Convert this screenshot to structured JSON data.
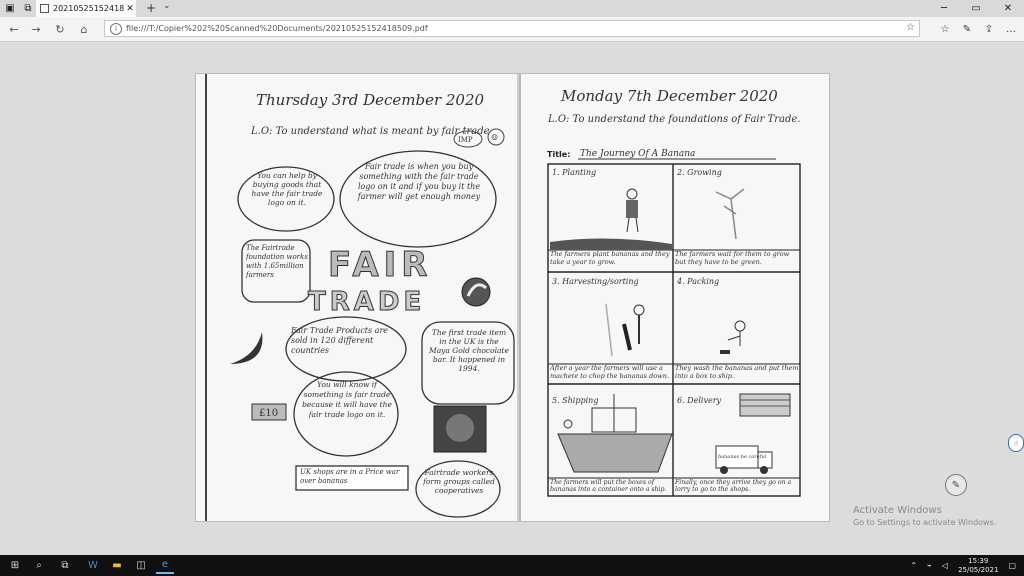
{
  "browser": {
    "tab_title": "20210525152418509.pc",
    "tab_close": "✕",
    "new_tab": "+",
    "address": "file:///T:/Copier%202%20Scanned%20Documents/20210525152418509.pdf",
    "window_controls": [
      "─",
      "▭",
      "✕"
    ]
  },
  "page_left": {
    "date": "Thursday 3rd December 2020",
    "lo": "L.O: To understand what is meant by fair trade",
    "imp": "IMP",
    "bubbles": [
      "You can help by buying goods that have the fair trade logo on it.",
      "Fair trade is when you buy something with the fair trade logo on it and if you buy it the farmer will get enough money",
      "The Fairtrade foundation works with 1.65million farmers",
      "Fair Trade Products are sold in 120 different countries",
      "The first trade item in the UK is the Maya Gold chocolate bar. It happened in 1994.",
      "You will know if something is fair trade because it will have the fair trade logo on it.",
      "Fairtrade workers form groups called cooperatives"
    ],
    "big_word_1": "FAIR",
    "big_word_2": "TRADE",
    "price_tag": "£10",
    "note_box": "UK shops are in a Price war over bananas"
  },
  "page_right": {
    "date": "Monday 7th December 2020",
    "lo": "L.O: To understand the foundations of Fair Trade.",
    "title_label": "Title:",
    "title": "The Journey Of A Banana",
    "panels": [
      {
        "heading": "1. Planting",
        "caption": "The farmers plant bananas and they take a year to grow."
      },
      {
        "heading": "2. Growing",
        "caption": "The farmers wait for them to grow but they have to be green."
      },
      {
        "heading": "3. Harvesting/sorting",
        "caption": "After a year the farmers will use a machete to chop the bananas down."
      },
      {
        "heading": "4. Packing",
        "caption": "They wash the bananas and put them into a box to ship."
      },
      {
        "heading": "5. Shipping",
        "caption": "The farmers will put the boxes of bananas into a container onto a ship."
      },
      {
        "heading": "6. Delivery",
        "caption": "Finally, once they arrive they go on a lorry to go to the shops."
      }
    ],
    "truck_label": "bananas be careful"
  },
  "overlay": {
    "activate_title": "Activate Windows",
    "activate_sub": "Go to Settings to activate Windows."
  },
  "taskbar": {
    "time": "15:39",
    "date": "25/05/2021"
  }
}
